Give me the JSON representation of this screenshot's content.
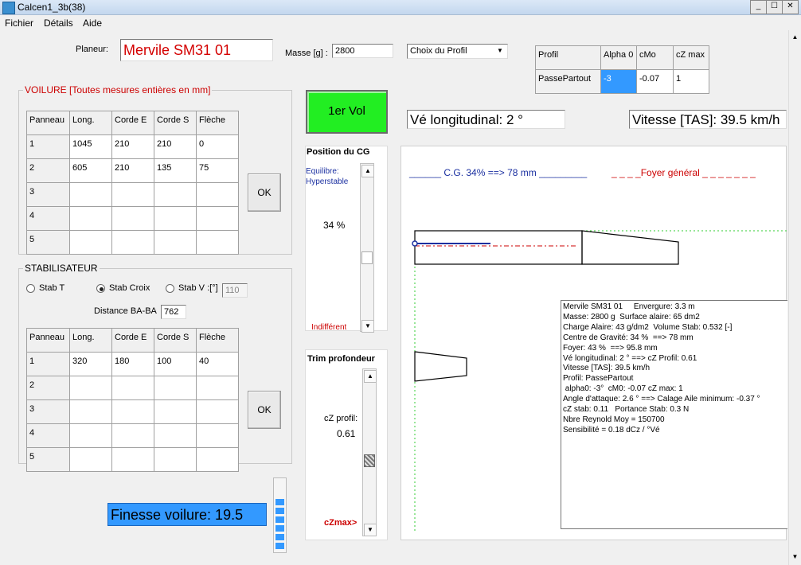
{
  "window": {
    "title": "Calcen1_3b(38)"
  },
  "menu": {
    "file": "Fichier",
    "details": "Détails",
    "help": "Aide"
  },
  "top": {
    "planeur_label": "Planeur:",
    "planeur_value": "Mervile SM31 01",
    "masse_label": "Masse [g] :",
    "masse_value": "2800",
    "profile_select": "Choix du Profil"
  },
  "profile_table": {
    "headers": [
      "Profil",
      "Alpha 0",
      "cMo",
      "cZ max"
    ],
    "row": [
      "PassePartout",
      "-3",
      "-0.07",
      "1"
    ]
  },
  "voilure": {
    "title": "VOILURE  [Toutes mesures entières en mm]",
    "headers": [
      "Panneau",
      "Long.",
      "Corde E",
      "Corde S",
      "Flèche"
    ],
    "rows": [
      [
        "1",
        "1045",
        "210",
        "210",
        "0"
      ],
      [
        "2",
        "605",
        "210",
        "135",
        "75"
      ],
      [
        "3",
        "",
        "",
        "",
        ""
      ],
      [
        "4",
        "",
        "",
        "",
        ""
      ],
      [
        "5",
        "",
        "",
        "",
        ""
      ]
    ],
    "ok": "OK"
  },
  "stab": {
    "title": "STABILISATEUR",
    "opt_t": "Stab T",
    "opt_croix": "Stab Croix",
    "opt_v": "Stab V :[°]",
    "v_angle": "110",
    "distance_label": "Distance BA-BA",
    "distance_value": "762",
    "headers": [
      "Panneau",
      "Long.",
      "Corde E",
      "Corde S",
      "Flèche"
    ],
    "rows": [
      [
        "1",
        "320",
        "180",
        "100",
        "40"
      ],
      [
        "2",
        "",
        "",
        "",
        ""
      ],
      [
        "3",
        "",
        "",
        "",
        ""
      ],
      [
        "4",
        "",
        "",
        "",
        ""
      ],
      [
        "5",
        "",
        "",
        "",
        ""
      ]
    ],
    "ok": "OK"
  },
  "first_flight": "1er Vol",
  "cg": {
    "title": "Position du CG",
    "eq": "Equilibre:",
    "hyper": "Hyperstable",
    "percent": "34 %",
    "indiff": "Indifférent"
  },
  "trim": {
    "title": "Trim profondeur",
    "cz_label": "cZ profil:",
    "cz_value": "0.61",
    "czmax": "cZmax>"
  },
  "ve": "Vé longitudinal: 2 °",
  "speed": "Vitesse [TAS]: 39.5 km/h",
  "finesse": "Finesse voilure: 19.5",
  "drawing": {
    "cg_text": "______ C.G. 34% ==> 78 mm _________",
    "foyer_text": "_ _ _ _Foyer général _ _ _ _ _ _ _"
  },
  "info_lines": [
    "Mervile SM31 01     Envergure: 3.3 m",
    "",
    "Masse: 2800 g  Surface alaire: 65 dm2",
    "Charge Alaire: 43 g/dm2  Volume Stab: 0.532 [-]",
    "",
    "Centre de Gravité: 34 %  ==> 78 mm",
    "Foyer: 43 %  ==> 95.8 mm",
    "",
    "Vé longitudinal: 2 ° ==> cZ Profil: 0.61",
    "Vitesse [TAS]: 39.5 km/h",
    "",
    "Profil: PassePartout",
    " alpha0: -3°  cM0: -0.07 cZ max: 1",
    "",
    "Angle d'attaque: 2.6 ° ==> Calage Aile minimum: -0.37 °",
    "",
    "cZ stab: 0.11   Portance Stab: 0.3 N",
    "Nbre Reynold Moy = 150700",
    "Sensibilité = 0.18 dCz / °Vé"
  ],
  "colors": {
    "accent_green": "#22ee22",
    "finesse_blue": "#3399ff",
    "red": "#cc0000",
    "blue": "#1a2fa0"
  }
}
